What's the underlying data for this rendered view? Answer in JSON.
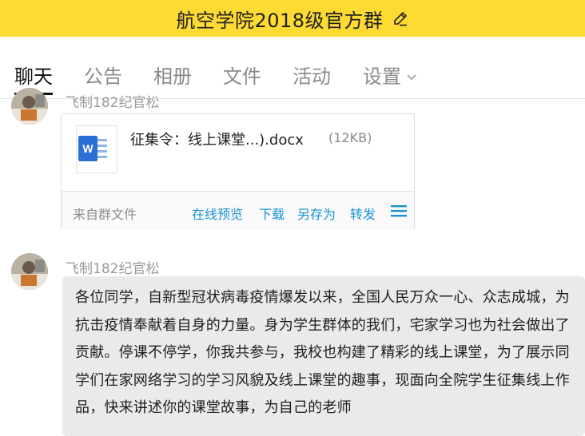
{
  "window": {
    "group_title": "航空学院2018级官方群"
  },
  "tabs": [
    {
      "label": "聊天",
      "active": true
    },
    {
      "label": "公告",
      "active": false
    },
    {
      "label": "相册",
      "active": false
    },
    {
      "label": "文件",
      "active": false
    },
    {
      "label": "活动",
      "active": false
    },
    {
      "label": "设置",
      "active": false
    }
  ],
  "messages": [
    {
      "sender": "飞制182纪官松",
      "type": "file",
      "file": {
        "name": "征集令：线上课堂...).docx",
        "size": "(12KB)",
        "icon": "word-doc-icon",
        "source": "来自群文件",
        "actions": [
          "在线预览",
          "下载",
          "另存为",
          "转发"
        ]
      }
    },
    {
      "sender": "飞制182纪官松",
      "type": "text",
      "text": "各位同学，自新型冠状病毒疫情爆发以来，全国人民万众一心、众志成城，为抗击疫情奉献着自身的力量。身为学生群体的我们，宅家学习也为社会做出了贡献。停课不停学，你我共参与，我校也构建了精彩的线上课堂，为了展示同学们在家网络学习的学习风貌及线上课堂的趣事，现面向全院学生征集线上作品，快来讲述你的课堂故事，为自己的老师"
    }
  ],
  "colors": {
    "title_bar": "#fddb33",
    "link": "#1a93d6",
    "bubble": "#eaeaea",
    "word_blue": "#2b6fd6"
  }
}
